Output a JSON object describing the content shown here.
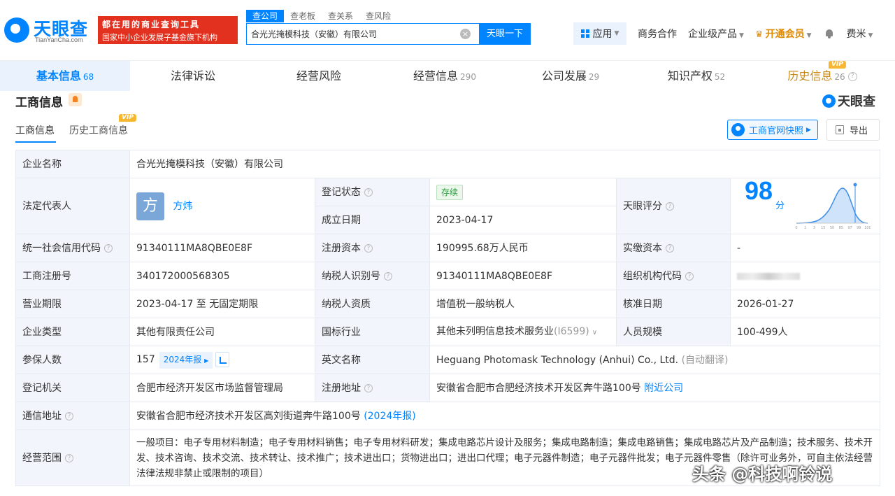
{
  "header": {
    "logo_text": "天眼查",
    "logo_sub": "TianYanCha.com",
    "ad_line1": "都在用的商业查询工具",
    "ad_line2": "国家中小企业发展子基金旗下机构",
    "search_tabs": [
      "查公司",
      "查老板",
      "查关系",
      "查风险"
    ],
    "search_value": "合光光掩模科技（安徽）有限公司",
    "search_button": "天眼一下",
    "app_label": "应用",
    "links": {
      "business": "商务合作",
      "enterprise": "企业级产品",
      "vip": "开通会员",
      "user": "费米"
    }
  },
  "tabs": [
    {
      "label": "基本信息",
      "count": "68"
    },
    {
      "label": "法律诉讼",
      "count": ""
    },
    {
      "label": "经营风险",
      "count": ""
    },
    {
      "label": "经营信息",
      "count": "290"
    },
    {
      "label": "公司发展",
      "count": "29"
    },
    {
      "label": "知识产权",
      "count": "52"
    },
    {
      "label": "历史信息",
      "count": "26"
    }
  ],
  "vip_badge": "VIP",
  "section": {
    "title": "工商信息",
    "brand": "天眼查",
    "sub_tabs": [
      "工商信息",
      "历史工商信息"
    ],
    "snapshot_button": "工商官网快照",
    "export_button": "导出"
  },
  "info": {
    "company_name_label": "企业名称",
    "company_name": "合光光掩模科技（安徽）有限公司",
    "legal_rep_label": "法定代表人",
    "legal_rep_avatar": "方",
    "legal_rep": "方炜",
    "reg_status_label": "登记状态",
    "reg_status": "存续",
    "founded_label": "成立日期",
    "founded": "2023-04-17",
    "score_label": "天眼评分",
    "score": "98",
    "score_unit": "分",
    "score_axis": [
      "0",
      "1",
      "3",
      "15",
      "50",
      "85",
      "97",
      "99",
      "100"
    ],
    "credit_code_label": "统一社会信用代码",
    "credit_code": "91340111MA8QBE0E8F",
    "reg_capital_label": "注册资本",
    "reg_capital": "190995.68万人民币",
    "paid_capital_label": "实缴资本",
    "paid_capital": "-",
    "reg_no_label": "工商注册号",
    "reg_no": "340172000568305",
    "taxpayer_id_label": "纳税人识别号",
    "taxpayer_id": "91340111MA8QBE0E8F",
    "org_code_label": "组织机构代码",
    "period_label": "营业期限",
    "period": "2023-04-17 至 无固定期限",
    "taxpayer_type_label": "纳税人资质",
    "taxpayer_type": "增值税一般纳税人",
    "approve_date_label": "核准日期",
    "approve_date": "2026-01-27",
    "company_type_label": "企业类型",
    "company_type": "其他有限责任公司",
    "industry_label": "国标行业",
    "industry": "其他未列明信息技术服务业",
    "industry_code": "(I6599)",
    "staff_label": "人员规模",
    "staff": "100-499人",
    "insured_label": "参保人数",
    "insured": "157",
    "insured_report": "2024年报",
    "english_name_label": "英文名称",
    "english_name": "Heguang Photomask Technology (Anhui) Co., Ltd.",
    "auto_translate": "(自动翻译)",
    "authority_label": "登记机关",
    "authority": "合肥市经济开发区市场监督管理局",
    "reg_address_label": "注册地址",
    "reg_address": "安徽省合肥市合肥经济技术开发区奔牛路100号",
    "nearby": "附近公司",
    "mail_address_label": "通信地址",
    "mail_address": "安徽省合肥市经济技术开发区高刘街道奔牛路100号",
    "mail_report": "(2024年报)",
    "scope_label": "经营范围",
    "scope": "一般项目：电子专用材料制造；电子专用材料销售；电子专用材料研发；集成电路芯片设计及服务；集成电路制造；集成电路销售；集成电路芯片及产品制造；技术服务、技术开发、技术咨询、技术交流、技术转让、技术推广；技术进出口；货物进出口；进出口代理；电子元器件制造；电子元器件批发；电子元器件零售（除许可业务外，可自主依法经营法律法规非禁止或限制的项目）"
  },
  "watermark": "头条 @科技啊铃说"
}
